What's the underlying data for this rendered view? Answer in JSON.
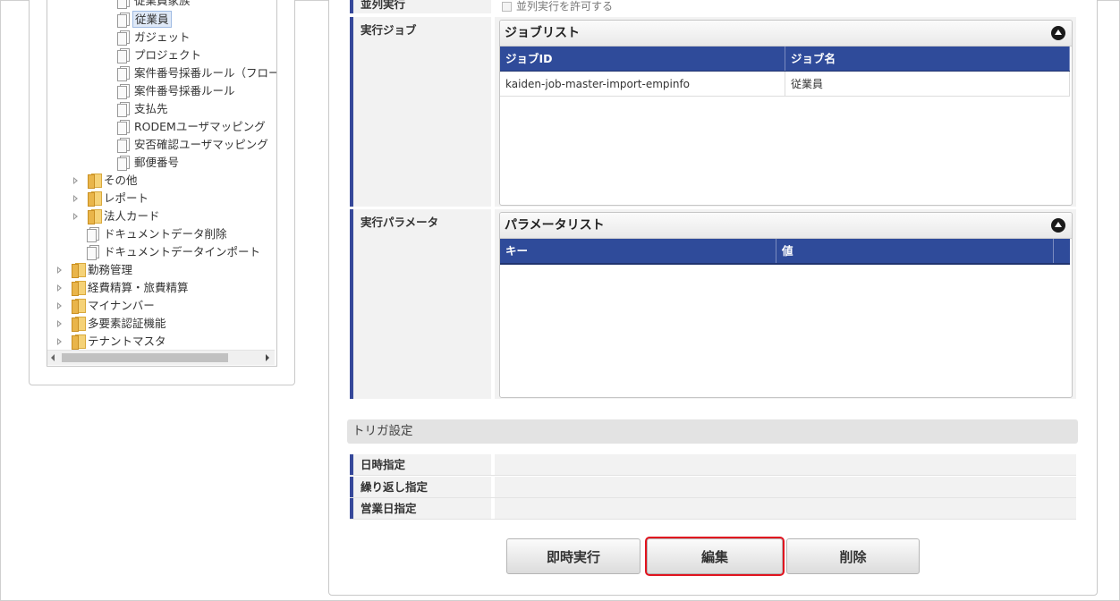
{
  "tree": {
    "items": [
      {
        "label": "従業員家族",
        "type": "file"
      },
      {
        "label": "従業員",
        "type": "file",
        "selected": true
      },
      {
        "label": "ガジェット",
        "type": "file"
      },
      {
        "label": "プロジェクト",
        "type": "file"
      },
      {
        "label": "案件番号採番ルール（フロー：",
        "type": "file"
      },
      {
        "label": "案件番号採番ルール",
        "type": "file"
      },
      {
        "label": "支払先",
        "type": "file"
      },
      {
        "label": "RODEMユーザマッピング",
        "type": "file"
      },
      {
        "label": "安否確認ユーザマッピング",
        "type": "file"
      },
      {
        "label": "郵便番号",
        "type": "file"
      },
      {
        "label": "その他",
        "type": "folder"
      },
      {
        "label": "レポート",
        "type": "folder"
      },
      {
        "label": "法人カード",
        "type": "folder"
      },
      {
        "label": "ドキュメントデータ削除",
        "type": "file"
      },
      {
        "label": "ドキュメントデータインポート",
        "type": "file"
      },
      {
        "label": "勤務管理",
        "type": "folder"
      },
      {
        "label": "経費精算・旅費精算",
        "type": "folder"
      },
      {
        "label": "マイナンバー",
        "type": "folder"
      },
      {
        "label": "多要素認証機能",
        "type": "folder"
      },
      {
        "label": "テナントマスタ",
        "type": "folder"
      }
    ]
  },
  "form": {
    "parallel": {
      "label": "並列実行",
      "checkbox_text": "並列実行を許可する"
    },
    "job": {
      "label": "実行ジョブ",
      "panel_title": "ジョブリスト",
      "columns": [
        "ジョブID",
        "ジョブ名"
      ],
      "rows": [
        [
          "kaiden-job-master-import-empinfo",
          "従業員"
        ]
      ]
    },
    "params": {
      "label": "実行パラメータ",
      "panel_title": "パラメータリスト",
      "columns": [
        "キー",
        "値"
      ]
    }
  },
  "trigger": {
    "section_title": "トリガ設定",
    "rows": [
      "日時指定",
      "繰り返し指定",
      "営業日指定"
    ]
  },
  "buttons": {
    "run_now": "即時実行",
    "edit": "編集",
    "delete": "削除"
  }
}
